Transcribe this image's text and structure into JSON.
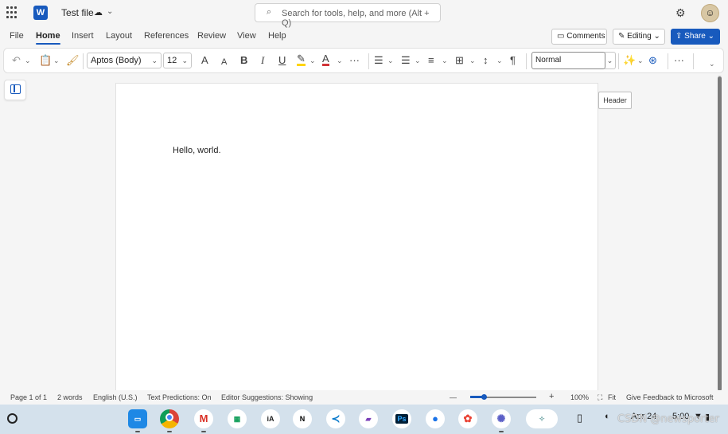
{
  "titlebar": {
    "doc_title": "Test file",
    "search_placeholder": "Search for tools, help, and more (Alt + Q)",
    "app_logo": "W"
  },
  "menu": {
    "tabs": [
      "File",
      "Home",
      "Insert",
      "Layout",
      "References",
      "Review",
      "View",
      "Help"
    ],
    "active_tab": "Home",
    "comments_label": "Comments",
    "editing_label": "Editing",
    "share_label": "Share"
  },
  "ribbon": {
    "font_name": "Aptos (Body)",
    "font_size": "12",
    "bold": "B",
    "italic": "I",
    "underline": "U",
    "grow_font": "A",
    "shrink_font": "A",
    "font_color": "A",
    "more": "···",
    "style": "Normal"
  },
  "document": {
    "body_text": "Hello, world.",
    "header_tooltip": "Header"
  },
  "status": {
    "page": "Page 1 of 1",
    "words": "2 words",
    "language": "English (U.S.)",
    "text_predictions": "Text Predictions: On",
    "editor_suggestions": "Editor Suggestions: Showing",
    "zoom_minus": "—",
    "zoom_plus": "+",
    "zoom": "100%",
    "fit": "Fit",
    "feedback": "Give Feedback to Microsoft"
  },
  "taskbar": {
    "date": "Apr 24",
    "time": "5:00",
    "watermark": "CSDN @newsporter"
  },
  "colors": {
    "accent": "#185abd",
    "highlight": "#ffd400",
    "font_red": "#d13438"
  }
}
